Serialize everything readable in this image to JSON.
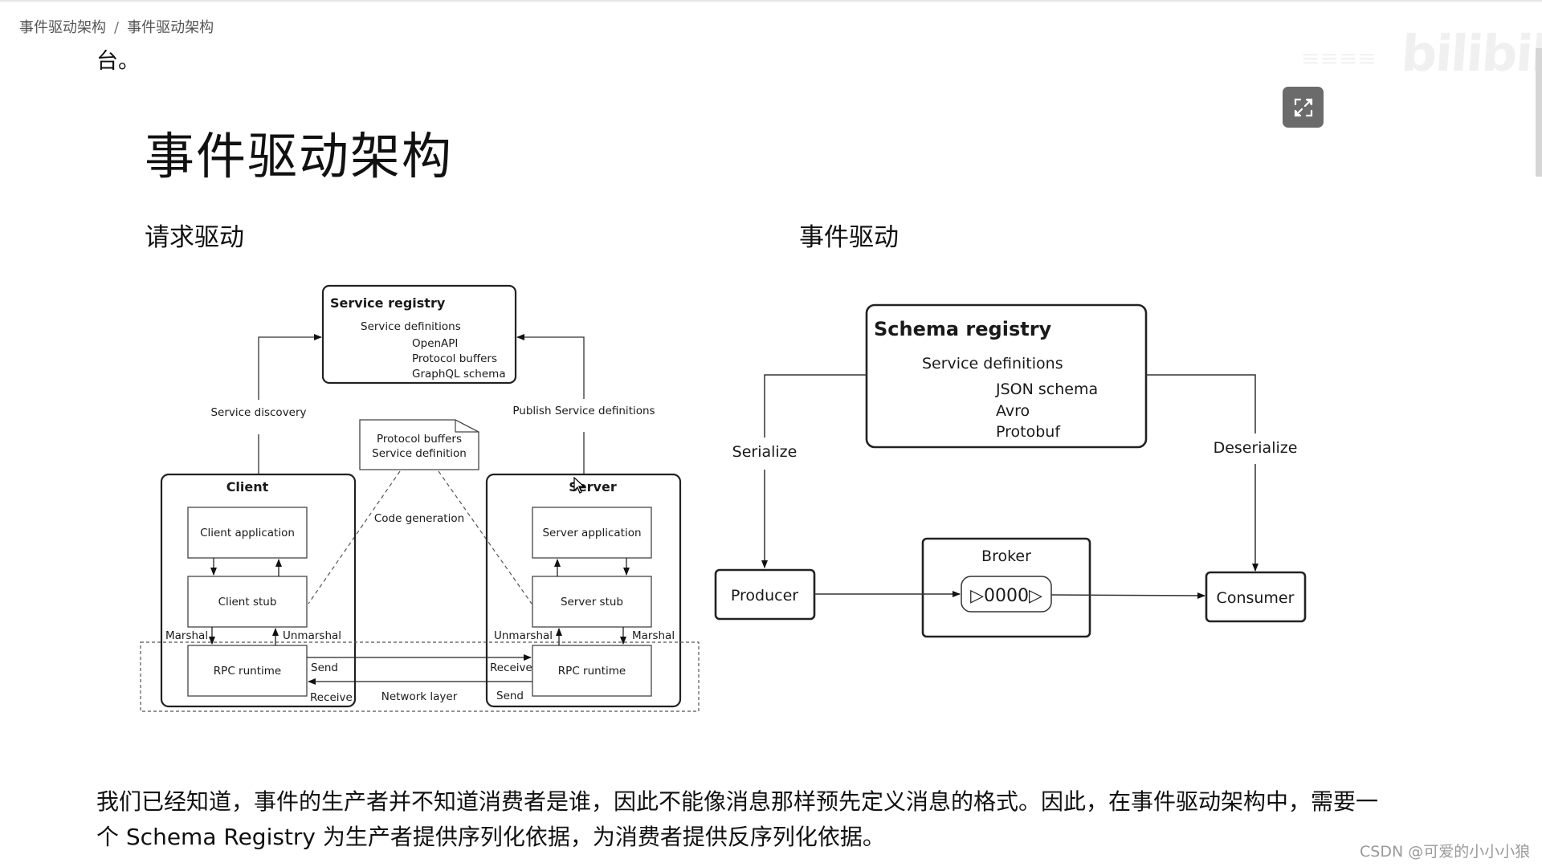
{
  "breadcrumb": [
    "事件驱动架构",
    "事件驱动架构"
  ],
  "breadcrumb_separator": "/",
  "previous_text_tail": "台。",
  "watermark": {
    "brand": "bilibili"
  },
  "expand_button": {
    "icon": "expand-icon"
  },
  "slide": {
    "title": "事件驱动架构",
    "left_heading": "请求驱动",
    "right_heading": "事件驱动"
  },
  "request_driven": {
    "service_registry": {
      "title": "Service registry",
      "subtitle": "Service definitions",
      "items": [
        "OpenAPI",
        "Protocol buffers",
        "GraphQL schema"
      ]
    },
    "service_discovery": "Service discovery",
    "publish_service_definitions": "Publish Service definitions",
    "protocol_doc": [
      "Protocol buffers",
      "Service definition"
    ],
    "code_generation": "Code generation",
    "client": {
      "title": "Client",
      "application": "Client application",
      "stub": "Client stub",
      "runtime": "RPC runtime",
      "marshal": "Marshal",
      "unmarshal": "Unmarshal",
      "send": "Send",
      "receive": "Receive"
    },
    "server": {
      "title": "Server",
      "application": "Server application",
      "stub": "Server stub",
      "runtime": "RPC runtime",
      "marshal": "Marshal",
      "unmarshal": "Unmarshal",
      "send": "Send",
      "receive": "Receive"
    },
    "network_layer": "Network layer"
  },
  "event_driven": {
    "schema_registry": {
      "title": "Schema registry",
      "subtitle": "Service definitions",
      "items": [
        "JSON schema",
        "Avro",
        "Protobuf"
      ]
    },
    "serialize": "Serialize",
    "deserialize": "Deserialize",
    "producer": "Producer",
    "broker": "Broker",
    "queue_glyph": "▷0000▷",
    "consumer": "Consumer"
  },
  "paragraph": {
    "line1": "我们已经知道，事件的生产者并不知道消费者是谁，因此不能像消息那样预先定义消息的格式。因此，在事件驱动架构中，需要一",
    "line2": "个 Schema Registry 为生产者提供序列化依据，为消费者提供反序列化依据。"
  },
  "csdn_watermark": "CSDN @可爱的小小小狼"
}
